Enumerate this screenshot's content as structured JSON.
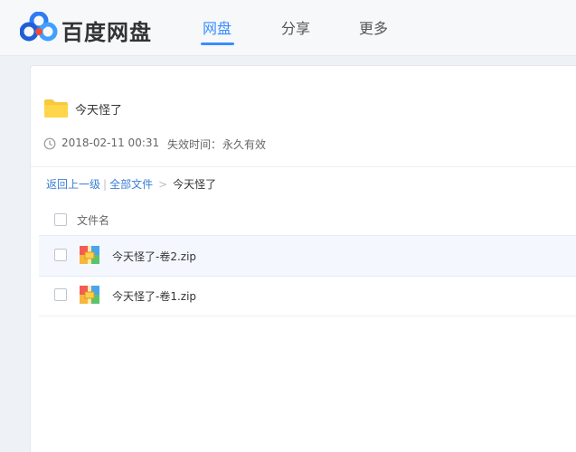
{
  "header": {
    "logo_text": "百度网盘",
    "nav": [
      {
        "label": "网盘",
        "active": true
      },
      {
        "label": "分享",
        "active": false
      },
      {
        "label": "更多",
        "active": false
      }
    ],
    "accent_color": "#3b8cff"
  },
  "share": {
    "title": "今天怪了",
    "time": "2018-02-11 00:31",
    "expire_label": "失效时间：",
    "expire_value": "永久有效",
    "folder_icon": "folder-icon",
    "clock_icon": "clock-icon"
  },
  "breadcrumb": {
    "back": "返回上一级",
    "separator": "|",
    "all_files": "全部文件",
    "arrow": ">",
    "current": "今天怪了"
  },
  "table": {
    "column_name": "文件名",
    "files": [
      {
        "name": "今天怪了-卷2.zip",
        "icon": "zip-icon"
      },
      {
        "name": "今天怪了-卷1.zip",
        "icon": "zip-icon"
      }
    ]
  }
}
